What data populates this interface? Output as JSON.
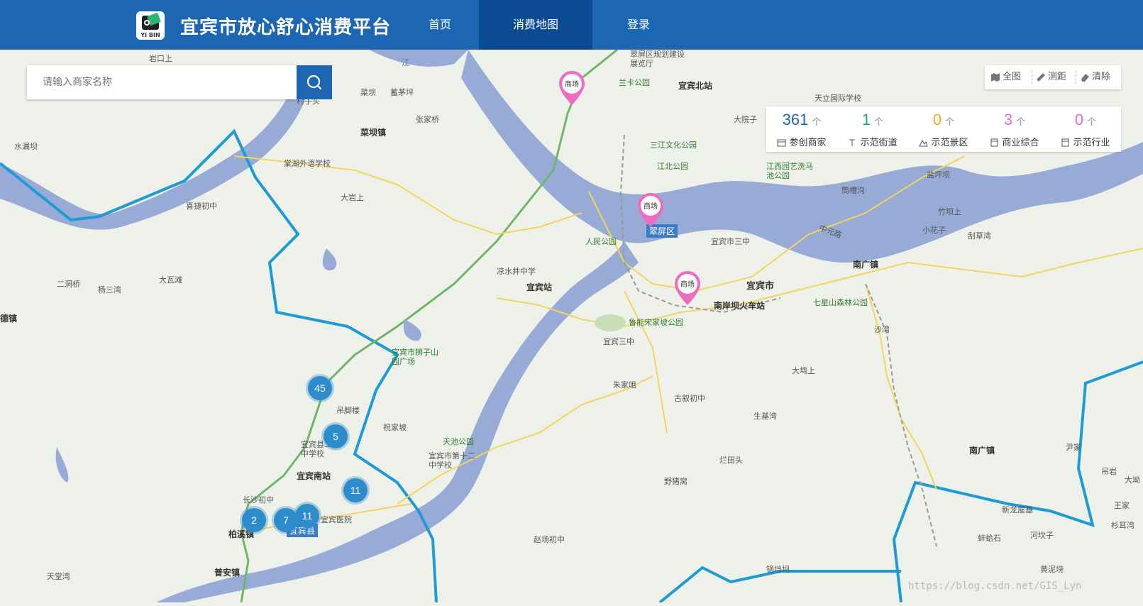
{
  "header": {
    "logo_text": "YI BIN",
    "title": "宜宾市放心舒心消费平台",
    "nav": [
      {
        "label": "首页"
      },
      {
        "label": "消费地图"
      },
      {
        "label": "登录"
      }
    ]
  },
  "search": {
    "placeholder": "请输入商家名称"
  },
  "toolbar": {
    "full_view": "全图",
    "measure": "测距",
    "clear": "清除"
  },
  "stats": {
    "unit": "个",
    "items": [
      {
        "count": "361",
        "label": "参创商家",
        "color": "#1c66b4"
      },
      {
        "count": "1",
        "label": "示范街道",
        "color": "#1aa683"
      },
      {
        "count": "0",
        "label": "示范景区",
        "color": "#f5a623"
      },
      {
        "count": "3",
        "label": "商业综合",
        "color": "#f06ac0"
      },
      {
        "count": "0",
        "label": "示范行业",
        "color": "#f06ac0"
      }
    ]
  },
  "markers": {
    "pin_label": "商场",
    "clusters": [
      "45",
      "5",
      "11",
      "2",
      "7",
      "11"
    ],
    "district": "翠屏区"
  },
  "map_labels": [
    "岩口上",
    "菜坝",
    "蓄茅坪",
    "村子头",
    "张家桥",
    "菜坝镇",
    "水漏坝",
    "棠湖外语学校",
    "大岩上",
    "喜捷初中",
    "二洞桥",
    "杨三湾",
    "大瓦滩",
    "德镇",
    "凉水井中学",
    "宜宾站",
    "人民公园",
    "宜宾市三中",
    "宜宾市",
    "南岸坝火车站",
    "七星山森林公园",
    "鲁能宋家坡公园",
    "宜宾三中",
    "朱家咀",
    "古叙初中",
    "大塆上",
    "生基湾",
    "宜宾市狮子山园广场",
    "吊脚楼",
    "祝家坡",
    "天池公园",
    "宜宾县二中学校",
    "宜宾市第十二中学校",
    "宜宾南站",
    "长沙初中",
    "柏溪镇",
    "宜宾医院",
    "宜宾县",
    "普安镇",
    "天堂湾",
    "赵场初中",
    "野猪窝",
    "烂田头",
    "南广镇",
    "尹家",
    "吊岩",
    "大坳",
    "王家",
    "杉耳湾",
    "河坎子",
    "蚌蛤石",
    "新龙屋基",
    "黄泥塝",
    "锅垱坝",
    "翠屏区规划建设展览厅",
    "兰卡公园",
    "宜宾北站",
    "三江文化公园",
    "江北公园",
    "大院子",
    "天立国际学校",
    "江西园艺洗马池公园",
    "盐坪坝",
    "筒槽沟",
    "竹坝上",
    "小花子",
    "刮草湾",
    "南广镇",
    "沙湾",
    "中元路",
    "江"
  ],
  "watermark": "https://blog.csdn.net/GIS_Lyn"
}
